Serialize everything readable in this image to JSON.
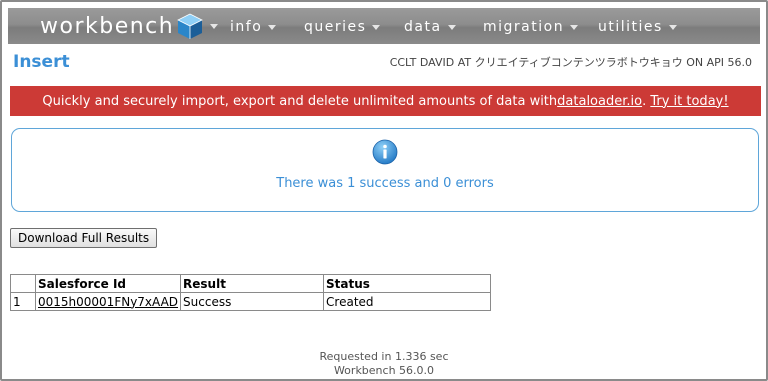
{
  "nav": {
    "logo_text": "workbench",
    "items": [
      {
        "label": "info"
      },
      {
        "label": "queries"
      },
      {
        "label": "data"
      },
      {
        "label": "migration"
      },
      {
        "label": "utilities"
      }
    ]
  },
  "page": {
    "title": "Insert",
    "user_info": "CCLT DAVID AT クリエイティブコンテンツラボトウキョウ ON API 56.0"
  },
  "banner": {
    "text_before": "Quickly and securely import, export and delete unlimited amounts of data with ",
    "link1": "dataloader.io",
    "text_between": ". ",
    "link2": "Try it today!"
  },
  "result": {
    "message": "There was 1 success and 0 errors"
  },
  "download_button": "Download Full Results",
  "table": {
    "headers": [
      "",
      "Salesforce Id",
      "Result",
      "Status"
    ],
    "rows": [
      {
        "num": "1",
        "id": "0015h00001FNy7xAAD",
        "result": "Success",
        "status": "Created"
      }
    ]
  },
  "footer": {
    "requested": "Requested in 1.336 sec",
    "version": "Workbench 56.0.0"
  },
  "colors": {
    "accent": "#3b8fd6",
    "banner": "#cc3a36",
    "navbar": "#8d8d8d"
  }
}
